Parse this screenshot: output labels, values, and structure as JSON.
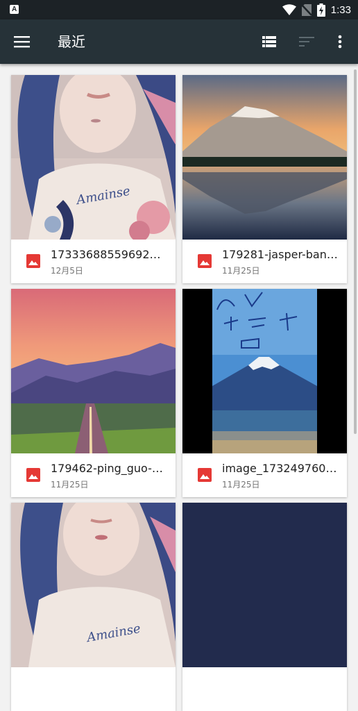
{
  "status_bar": {
    "time": "1:33",
    "icons": [
      "notification-a-icon",
      "wifi-icon",
      "no-sim-icon",
      "battery-charging-icon"
    ]
  },
  "toolbar": {
    "title": "最近",
    "icons": [
      "hamburger-menu-icon",
      "list-view-icon",
      "sort-icon",
      "more-vert-icon"
    ],
    "bg_color": "#263238"
  },
  "files": [
    {
      "name": "17333688559692…",
      "date": "12月5日",
      "icon": "image-file-icon"
    },
    {
      "name": "179281-jasper-ban…",
      "date": "11月25日",
      "icon": "image-file-icon"
    },
    {
      "name": "179462-ping_guo-…",
      "date": "11月25日",
      "icon": "image-file-icon"
    },
    {
      "name": "image_173249760…",
      "date": "11月25日",
      "icon": "image-file-icon"
    }
  ],
  "colors": {
    "file_icon": "#e53935",
    "accent": "#263238"
  }
}
